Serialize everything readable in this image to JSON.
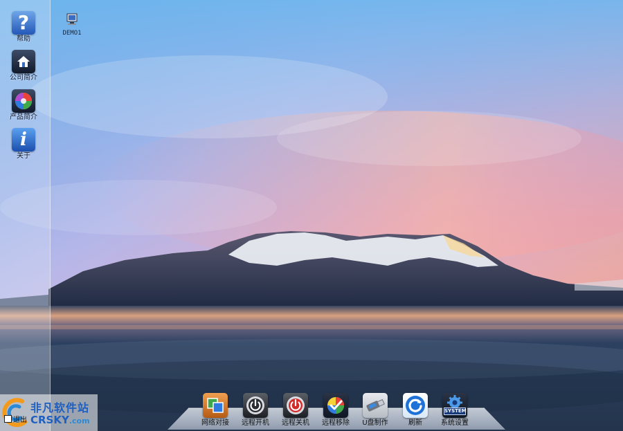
{
  "sidebar": {
    "items": [
      {
        "label": "帮助",
        "icon": "help-icon"
      },
      {
        "label": "公司简介",
        "icon": "company-house-icon"
      },
      {
        "label": "产品简介",
        "icon": "product-color-wheel-icon"
      },
      {
        "label": "关于",
        "icon": "info-icon"
      }
    ]
  },
  "desktop": {
    "icons": [
      {
        "label": "DEMO1",
        "icon": "computer-icon"
      }
    ]
  },
  "dock": {
    "items": [
      {
        "label": "网络对接",
        "icon": "network-link-icon"
      },
      {
        "label": "远程开机",
        "icon": "power-on-icon"
      },
      {
        "label": "远程关机",
        "icon": "power-off-icon"
      },
      {
        "label": "远程移除",
        "icon": "remote-remove-icon"
      },
      {
        "label": "U盘制作",
        "icon": "usb-drive-icon"
      },
      {
        "label": "刷新",
        "icon": "refresh-icon"
      },
      {
        "label": "系统设置",
        "icon": "system-settings-icon",
        "badge": "SYSTEM"
      }
    ]
  },
  "taskbar": {
    "start_label": "退出"
  },
  "watermark": {
    "name": "非凡软件站",
    "domain_main": "CRSKY",
    "domain_tld": ".com"
  },
  "colors": {
    "accent_blue": "#1f5fc0",
    "sky_top": "#4f9ee0",
    "sky_pink": "#e8a0b8",
    "water": "#26384f"
  }
}
